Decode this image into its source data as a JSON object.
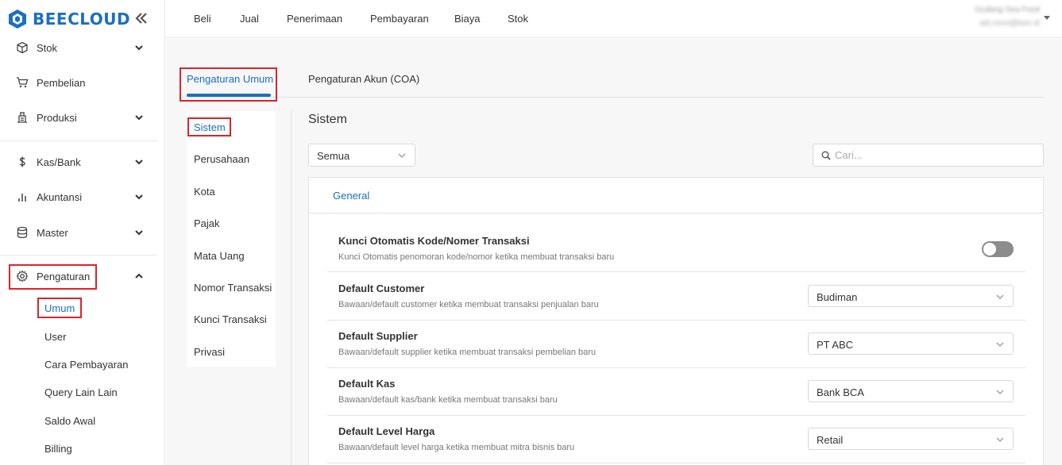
{
  "brand": {
    "name": "BEECLOUD",
    "color": "#1a6fc4"
  },
  "sidebar": {
    "items": [
      {
        "label": "Stok",
        "icon": "box-icon",
        "has_chevron": true
      },
      {
        "label": "Pembelian",
        "icon": "cart-icon",
        "has_chevron": false
      },
      {
        "label": "Produksi",
        "icon": "production-icon",
        "has_chevron": true
      },
      {
        "label": "Kas/Bank",
        "icon": "dollar-icon",
        "has_chevron": true
      },
      {
        "label": "Akuntansi",
        "icon": "bar-chart-icon",
        "has_chevron": true
      },
      {
        "label": "Master",
        "icon": "database-icon",
        "has_chevron": true
      },
      {
        "label": "Pengaturan",
        "icon": "gear-icon",
        "has_chevron": true,
        "expanded": true
      }
    ],
    "subitems": [
      "Umum",
      "User",
      "Cara Pembayaran",
      "Query Lain Lain",
      "Saldo Awal",
      "Billing"
    ],
    "active_subitem": "Umum"
  },
  "topnav": [
    "Beli",
    "Jual",
    "Penerimaan",
    "Pembayaran",
    "Biaya",
    "Stok"
  ],
  "user": {
    "name": "Gudang Sea Food",
    "email": "adi.renni@bee.id"
  },
  "tabs": [
    "Pengaturan Umum",
    "Pengaturan Akun (COA)"
  ],
  "active_tab": "Pengaturan Umum",
  "subnav": [
    "Sistem",
    "Perusahaan",
    "Kota",
    "Pajak",
    "Mata Uang",
    "Nomor Transaksi",
    "Kunci Transaksi",
    "Privasi"
  ],
  "active_subnav": "Sistem",
  "section": {
    "title": "Sistem",
    "filter_value": "Semua",
    "search_placeholder": "Cari...",
    "card_tab": "General",
    "settings": [
      {
        "title": "Kunci Otomatis Kode/Nomer Transaksi",
        "desc": "Kunci Otomatis penomoran kode/nomor ketika membuat transaksi baru",
        "type": "toggle",
        "value": false
      },
      {
        "title": "Default Customer",
        "desc": "Bawaan/default customer ketika membuat transaksi penjualan baru",
        "type": "select",
        "value": "Budiman"
      },
      {
        "title": "Default Supplier",
        "desc": "Bawaan/default supplier ketika membuat transaksi pembelian baru",
        "type": "select",
        "value": "PT ABC"
      },
      {
        "title": "Default Kas",
        "desc": "Bawaan/default kas/bank ketika membuat transaksi baru",
        "type": "select",
        "value": "Bank BCA"
      },
      {
        "title": "Default Level Harga",
        "desc": "Bawaan/default level harga ketika membuat mitra bisnis baru",
        "type": "select",
        "value": "Retail"
      }
    ]
  }
}
